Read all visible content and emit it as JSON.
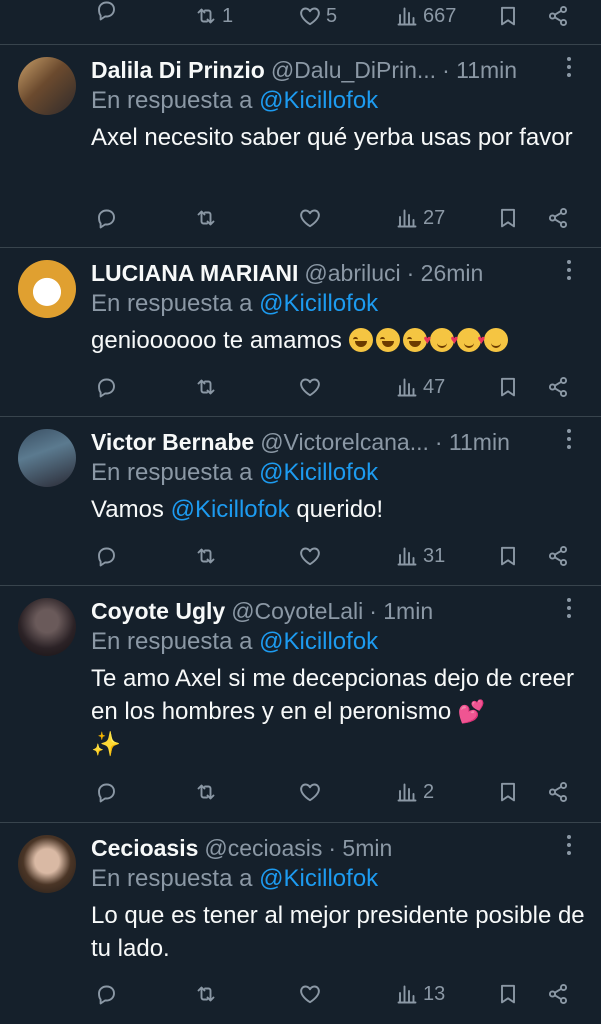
{
  "top_actions": {
    "reposts": "1",
    "likes": "5",
    "views": "667"
  },
  "reply_prefix": "En respuesta a",
  "reply_target": "@Kicillofok",
  "tweets": [
    {
      "name": "Dalila Di Prinzio",
      "handle": "@Dalu_DiPrin...",
      "time": "· 11min",
      "text": "Axel necesito saber qué yerba usas por favor",
      "views": "27"
    },
    {
      "name": "LUCIANA MARIANI",
      "handle": "@abriluci",
      "time": "· 26min",
      "text": "genioooooo te amamos",
      "views": "47"
    },
    {
      "name": "Victor Bernabe",
      "handle": "@Victorelcana...",
      "time": "· 11min",
      "text_before": "Vamos",
      "text_mention": "@Kicillofok",
      "text_after": "querido!",
      "views": "31"
    },
    {
      "name": "Coyote Ugly",
      "handle": "@CoyoteLali",
      "time": "· 1min",
      "text": "Te amo Axel si me decepcionas dejo de creer en los hombres y en el peronismo",
      "views": "2"
    },
    {
      "name": "Cecioasis",
      "handle": "@cecioasis",
      "time": "· 5min",
      "text": "Lo que es tener al mejor presidente posible de tu lado.",
      "views": "13"
    }
  ],
  "colors": {
    "background": "#15202b",
    "text": "#f7f9f9",
    "secondary": "#8b98a5",
    "accent": "#1d9bf0",
    "divider": "#38444d"
  }
}
